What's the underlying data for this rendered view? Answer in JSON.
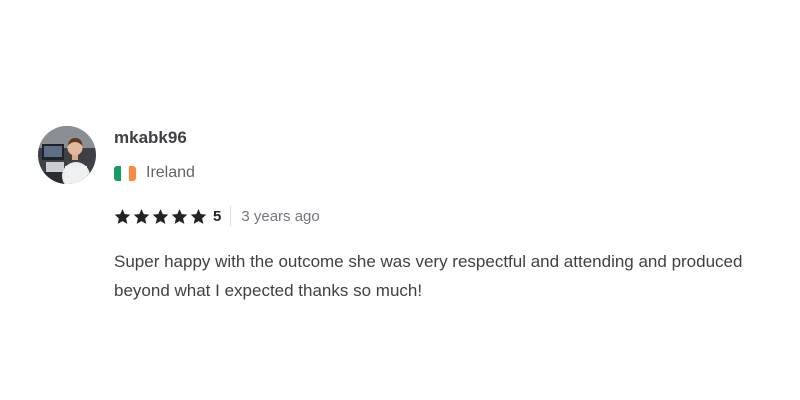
{
  "reviewer": {
    "username": "mkabk96",
    "country": "Ireland",
    "flag_colors": [
      "#169b62",
      "#ffffff",
      "#ff883e"
    ],
    "avatar_icon": "user-avatar-photo"
  },
  "rating": {
    "stars": 5,
    "max_stars": 5,
    "score_label": "5",
    "star_color": "#222325",
    "time_ago": "3 years ago"
  },
  "review": {
    "text": "Super happy with the outcome she was very respectful and attending and produced beyond what I expected thanks so much!"
  }
}
